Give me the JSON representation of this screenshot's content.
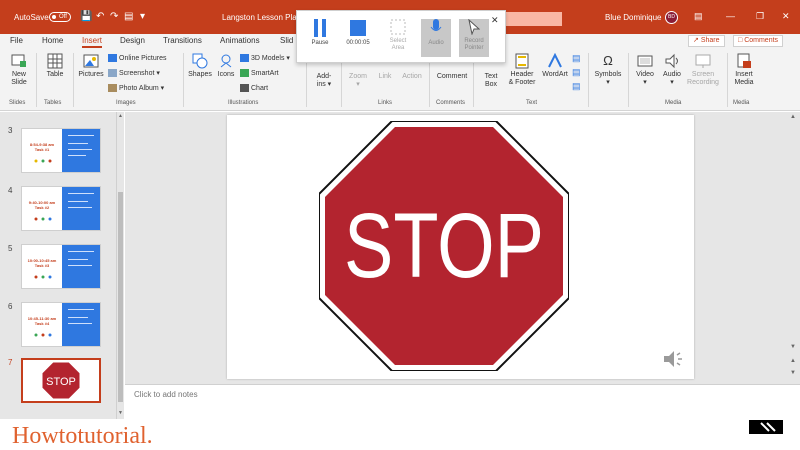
{
  "titlebar": {
    "autosave_label": "AutoSave",
    "autosave_state": "Off",
    "document_title": "Langston Lesson Plan",
    "user_name": "Blue Dominique",
    "user_initials": "BD",
    "accent": "#c43e1c"
  },
  "tabs": [
    {
      "label": "File"
    },
    {
      "label": "Home"
    },
    {
      "label": "Insert",
      "active": true
    },
    {
      "label": "Design"
    },
    {
      "label": "Transitions"
    },
    {
      "label": "Animations"
    },
    {
      "label": "Slid"
    }
  ],
  "header_buttons": {
    "share": "Share",
    "comments": "Comments"
  },
  "ribbon": {
    "slides": {
      "new_slide": "New\nSlide",
      "group": "Slides"
    },
    "tables": {
      "table": "Table",
      "group": "Tables"
    },
    "images": {
      "pictures": "Pictures",
      "online_pictures": "Online Pictures",
      "screenshot": "Screenshot",
      "photo_album": "Photo Album",
      "group": "Images"
    },
    "illustrations": {
      "shapes": "Shapes",
      "icons": "Icons",
      "models": "3D Models",
      "smartart": "SmartArt",
      "chart": "Chart",
      "group": "Illustrations"
    },
    "addins": {
      "label": "Add-\nins"
    },
    "links": {
      "zoom": "Zoom",
      "link": "Link",
      "action": "Action",
      "group": "Links"
    },
    "comments": {
      "comment": "Comment",
      "group": "Comments"
    },
    "text": {
      "textbox": "Text\nBox",
      "header_footer": "Header\n& Footer",
      "wordart": "WordArt",
      "group": "Text"
    },
    "symbols": {
      "symbols": "Symbols"
    },
    "media": {
      "video": "Video",
      "audio": "Audio",
      "screen_recording": "Screen\nRecording",
      "group": "Media"
    },
    "media2": {
      "insert_media": "Insert\nMedia",
      "group": "Media"
    }
  },
  "recording_toolbar": {
    "pause": "Pause",
    "stop_time": "00:00:05",
    "select_area": "Select\nArea",
    "audio": "Audio",
    "record_pointer": "Record\nPointer",
    "close": "✕"
  },
  "slides_panel": [
    {
      "number": "3",
      "title": "8:54-9:38 am\nTask #1",
      "dots": [
        "#e6b800",
        "#3aa655",
        "#c43e1c"
      ]
    },
    {
      "number": "4",
      "title": "9:40-10:00 am\nTask #2",
      "dots": [
        "#c43e1c",
        "#3aa655",
        "#2f78e0"
      ]
    },
    {
      "number": "5",
      "title": "10:00-10:45 am\nTask #3",
      "dots": [
        "#c43e1c",
        "#3aa655",
        "#2f78e0"
      ]
    },
    {
      "number": "6",
      "title": "10:45-11:30 am\nTask #4",
      "dots": [
        "#3aa655",
        "#c43e1c",
        "#2f78e0"
      ]
    },
    {
      "number": "7",
      "title": "STOP",
      "selected": true
    }
  ],
  "slide": {
    "sign_text": "STOP",
    "sign_color": "#b3242f"
  },
  "notes": {
    "placeholder": "Click to add notes"
  },
  "watermark": "Howtotutorial."
}
